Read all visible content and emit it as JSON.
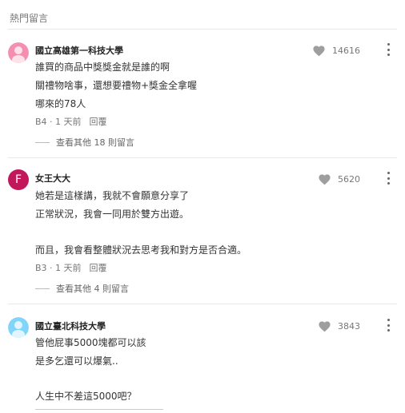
{
  "section_title": "熱門留言",
  "comments": [
    {
      "author": "國立高雄第一科技大學",
      "lines": [
        "誰買的商品中獎獎金就是誰的啊",
        "關禮物啥事，還想要禮物+獎金全拿喔",
        "哪來的78人"
      ],
      "floor": "B4",
      "time": "1 天前",
      "reply_label": "回覆",
      "more_replies": "查看其他 18 則留言",
      "likes": "14616",
      "avatar_icon": "pink-school-avatar-icon"
    },
    {
      "author": "女王大大",
      "avatar_letter": "F",
      "lines": [
        "她若是這樣講，我就不會願意分享了",
        "正常狀況，我會一同用於雙方出遊。",
        "",
        "而且，我會看整體狀況去思考我和對方是否合適。"
      ],
      "floor": "B3",
      "time": "1 天前",
      "reply_label": "回覆",
      "more_replies": "查看其他 4 則留言",
      "likes": "5620"
    },
    {
      "author": "國立臺北科技大學",
      "lines": [
        "管他屁事5000塊都可以該",
        "是多乞還可以爆氣..",
        "",
        "人生中不差這5000吧？"
      ],
      "likes": "3843",
      "avatar_icon": "blue-school-avatar-icon"
    }
  ],
  "colors": {
    "like_icon": "#9e9e9e",
    "avatar_letter_bg": "#c2185b"
  }
}
